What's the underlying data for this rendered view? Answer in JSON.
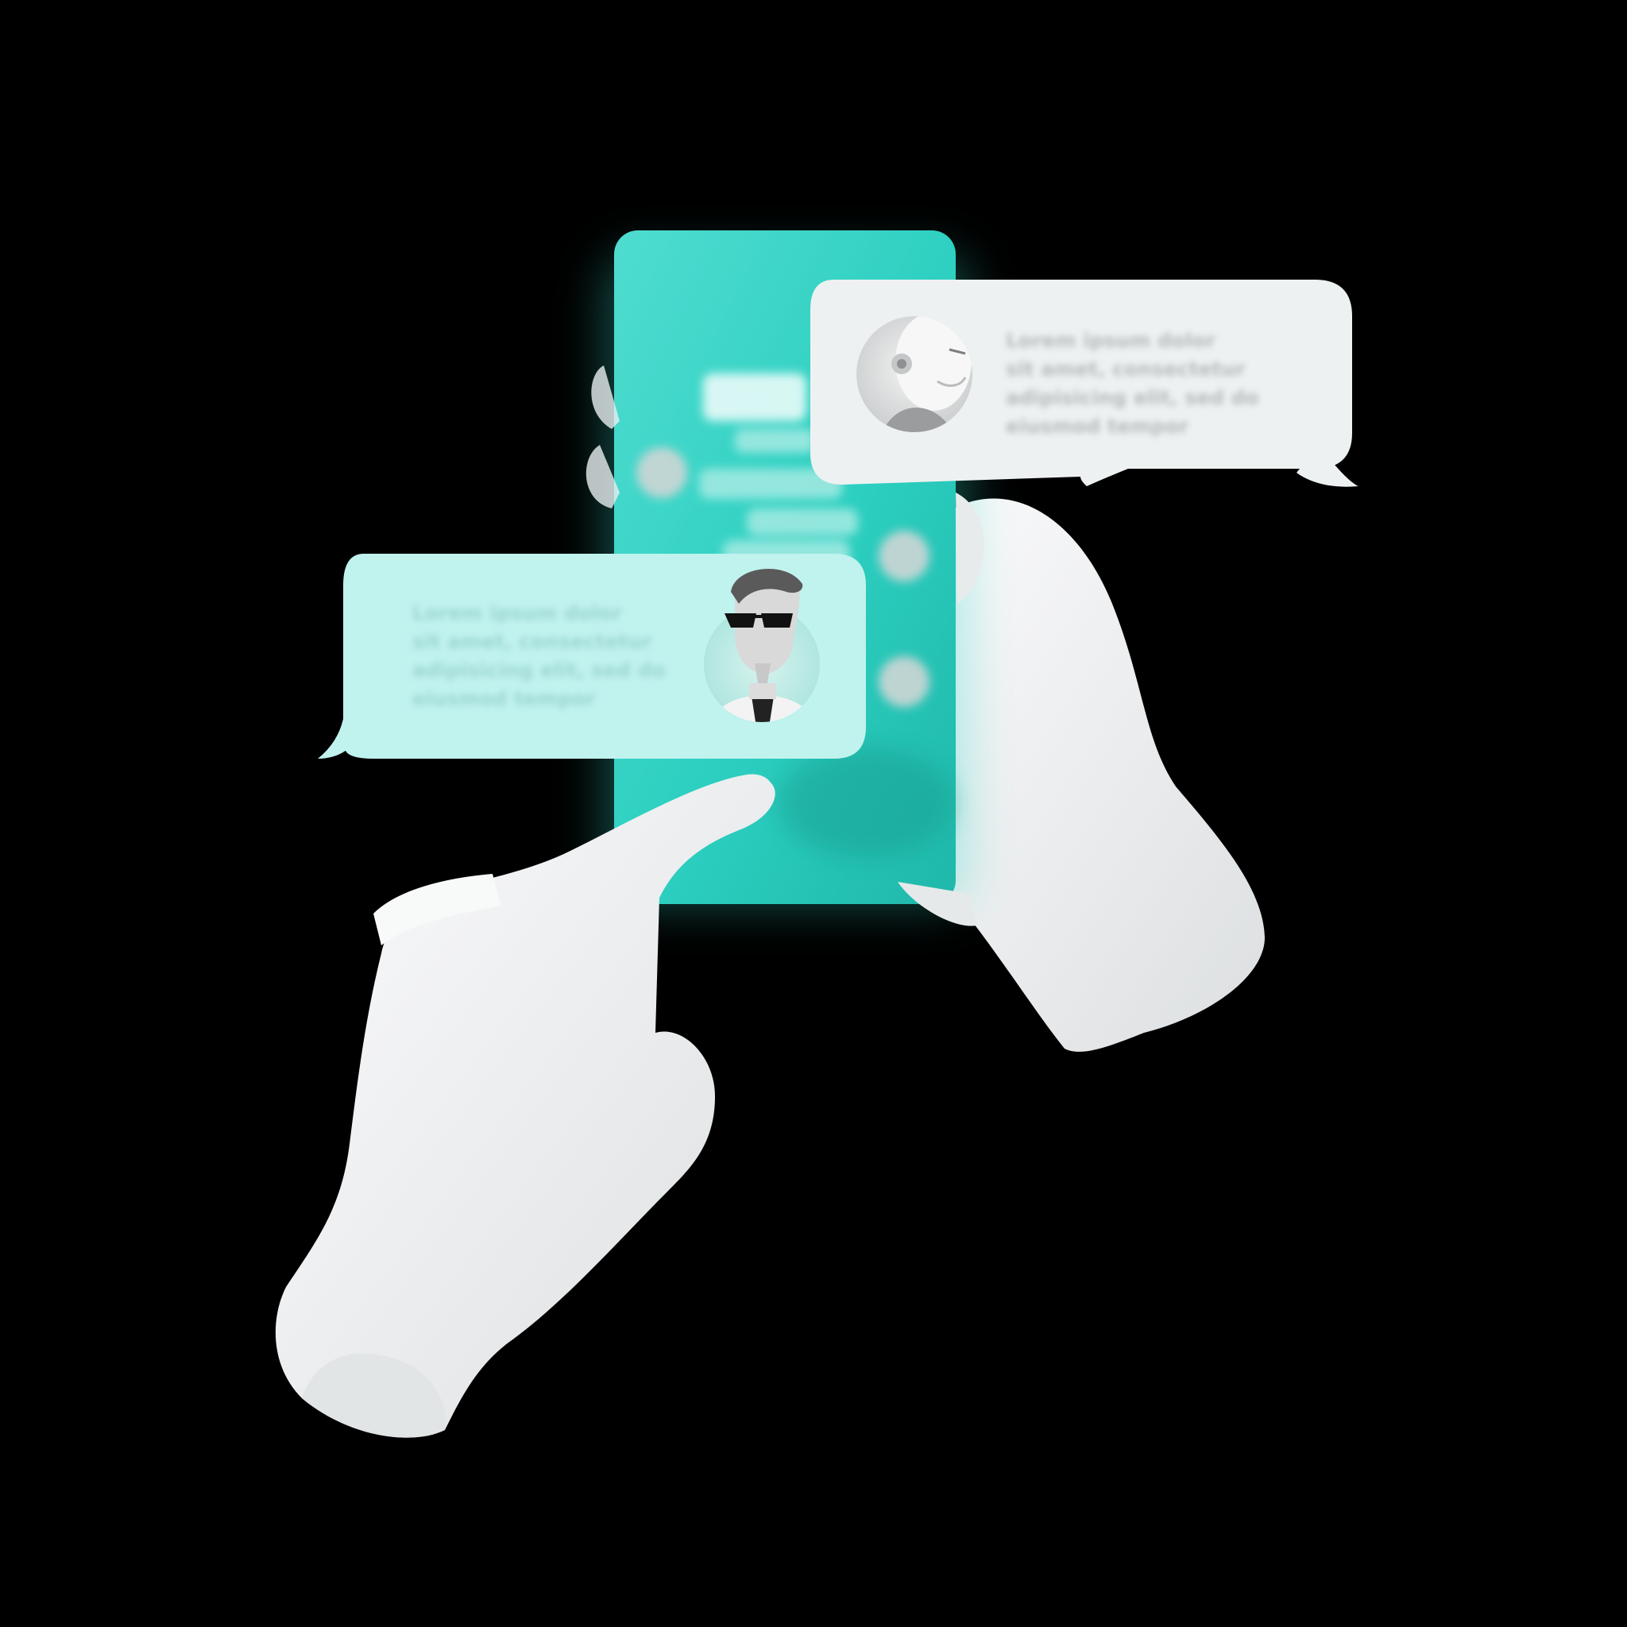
{
  "bot_message": {
    "lines": [
      "Lorem ipsum dolor",
      "sit amet, consectetur",
      "adipisicing elit, sed do",
      "eiusmod tempor"
    ]
  },
  "user_message": {
    "lines": [
      "Lorem ipsum dolor",
      "sit amet, consectetur",
      "adipisicing elit, sed do",
      "eiusmod tempor"
    ]
  },
  "colors": {
    "background": "#000000",
    "phone_teal": "#3fd6c8",
    "bot_bubble": "#eef2f2",
    "user_bubble": "#c0f2ee",
    "hand": "#f2f3f4"
  },
  "icons": {
    "bot_avatar": "robot-head-avatar",
    "user_avatar": "man-with-sunglasses-avatar"
  }
}
